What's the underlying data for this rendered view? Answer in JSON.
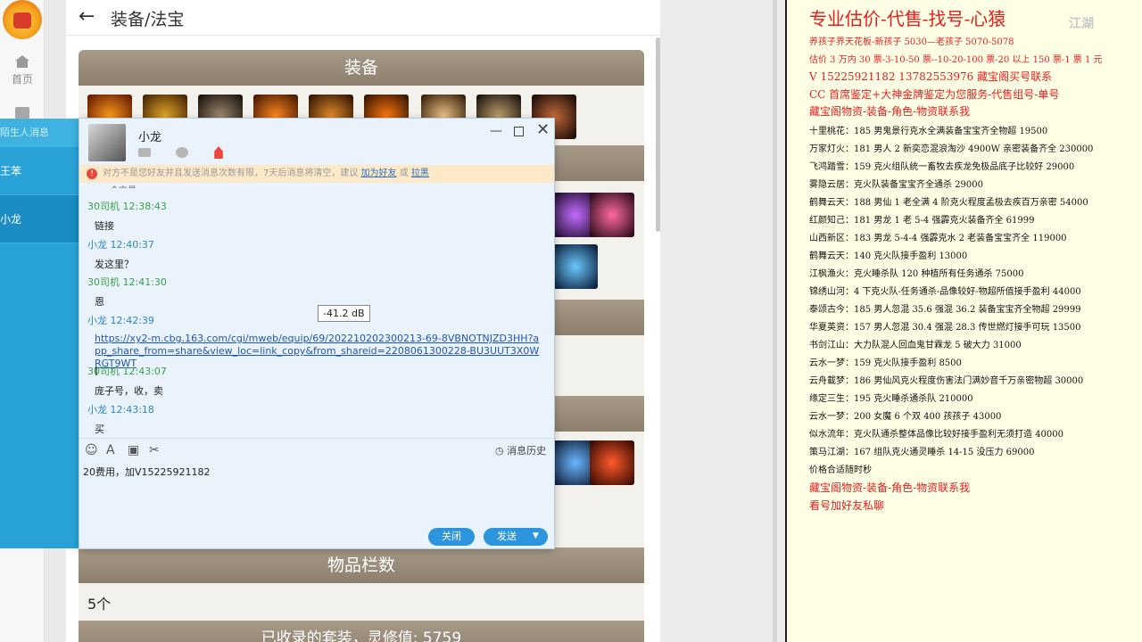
{
  "nav": {
    "home_label": "首页"
  },
  "header": {
    "back_icon": "arrow-left-icon",
    "title": "装备/法宝"
  },
  "sections": {
    "equipment": "装备",
    "slots": "物品栏数",
    "slots_value": "5个",
    "collected": "已收录的套装，灵修值: 5759"
  },
  "blue_panel": {
    "top": "陌生人消息",
    "items": [
      "王苯",
      "小龙"
    ]
  },
  "chat": {
    "name": "小龙",
    "notice_pre": "对方不是您好友并且发送消息次数有限，7天后消息将清空，建议",
    "notice_add": "加为好友",
    "notice_or": "或",
    "notice_block": "拉黑",
    "cut_text": "一个交易",
    "messages": [
      {
        "sender": "30司机",
        "time": "12:38:43",
        "text": "链接"
      },
      {
        "sender": "小龙",
        "time": "12:40:37",
        "text": "发这里？"
      },
      {
        "sender": "30司机",
        "time": "12:41:30",
        "text": "恩"
      },
      {
        "sender": "小龙",
        "time": "12:42:39",
        "link": "https://xy2-m.cbg.163.com/cgi/mweb/equip/69/202210202300213-69-8VBNOTNJZD3HH?app_share_from=share&view_loc=link_copy&from_shareid=2208061300228-BU3UUT3X0WRGT9WT"
      },
      {
        "sender": "30司机",
        "time": "12:43:07",
        "text": "庞子号，收，卖"
      },
      {
        "sender": "小龙",
        "time": "12:43:18",
        "text": "买"
      }
    ],
    "tooltip": "-41.2 dB",
    "history": "消息历史",
    "input_value": "20费用，加V15225921182",
    "close_btn": "关闭",
    "send_btn": "发送"
  },
  "doc": {
    "title": "专业估价-代售-找号-心猿",
    "red_lines": [
      "养孩子界天花板-新孩子 5030—老孩子 5070-5078",
      "估价 3 万内 30 票-3-10-50 票--10-20-100 票-20 以上 150 票-1 票 1 元",
      "V 15225921182       13782553976    藏宝阁买号联系",
      "CC 首席鉴定+大神金牌鉴定为您服务-代售组号-单号",
      "藏宝阁物资-装备-角色-物资联系我"
    ],
    "lines": [
      "十里桃花：185 男鬼景行克水全满装备宝宝齐全物超 19500",
      "万家灯火：181 男人 2 新奕恋混浪淘沙 4900W 亲密装备齐全 230000",
      "飞鸿踏雪：159 克火组队统一畜牧去疾龙免极品底子比较好 29000",
      "雾隐云居：克火队装备宝宝齐全通杀 29000",
      "鹤舞云天：188 男仙 1 老全满 4 阶克火程度孟极去疾百万亲密 54000",
      "红颜知己：181 男龙 1 老 5-4 强霹克火装备齐全 61999",
      "山西新区：183 男龙 5-4-4 强霹克水 2 老装备宝宝齐全 119000",
      "鹤舞云天：140 克火队接手盈利 13000",
      "江枫渔火：克火睡杀队 120 种植所有任务通杀 75000",
      "锦绣山河：4 下克火队-任务通杀-品像较好-物超所值接手盈利 44000",
      "泰颂古今：185 男人忽混 35.6 强混 36.2 装备宝宝齐全物超 29999",
      "华夏英资：157 男人忽混 30.4 强混 28.3 传世燃灯接手可玩 13500",
      "书剑江山：大力队混人回血鬼甘霖龙 5 破大力 31000",
      "云水一梦：159 克火队接手盈利 8500",
      "云舟載梦：186 男仙风克火程度伤害法门满妙音千万亲密物超 30000",
      "缘定三生：195 克火睡杀通杀队 210000",
      "云水一梦：200 女魔 6 个双 400 孩孩子 43000",
      "似水流年：克火队通杀整体品像比较好接手盈利无须打造 40000",
      "策马江湖：167 组队克火通灵睡杀 14-15 没压力 69000",
      "价格合适随时秒"
    ],
    "red_tail": [
      "藏宝阁物资-装备-角色-物资联系我",
      "看号加好友私聊"
    ],
    "watermark": "江湖"
  }
}
